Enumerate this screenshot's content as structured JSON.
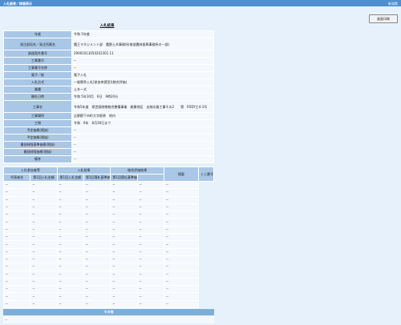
{
  "header": {
    "title": "入札結果／詳細表示",
    "right_label": "新潟県"
  },
  "toolbar": {
    "print_label": "画面印刷"
  },
  "result_title": "入札結果",
  "info_rows": [
    {
      "label": "年度",
      "value": "令和 5年度"
    },
    {
      "label": "発注部局名／発注所属名",
      "value": "農王マネジメント部　農野土木事務所(南部農林振興事務所の一部)"
    },
    {
      "label": "調達案件番号",
      "value": "29001013050202301 11"
    },
    {
      "label": "工事番号",
      "value": "--"
    },
    {
      "label": "工事番号名称",
      "value": "--"
    },
    {
      "label": "電子／紙",
      "value": "電子入札"
    },
    {
      "label": "入札方式",
      "value": "一般競争入札[参加申請型](総合評価)"
    },
    {
      "label": "業種",
      "value": "土木一式"
    },
    {
      "label": "開札日時",
      "value": "令和 5年10月　6日　9時20分"
    },
    {
      "label": "工事名",
      "value": "令和5年度　県営畑地帯総合整備事業　総康地区　支線水路工事その2　　第　R5DY工4-3号"
    },
    {
      "label": "工事場所",
      "value": "吉野郡下市町大字栃原　地内"
    },
    {
      "label": "工期",
      "value": "令和　6年　8月30日まで"
    },
    {
      "label": "予定価格(税抜)",
      "value": "--"
    },
    {
      "label": "予定価格(税抜)",
      "value": "--"
    },
    {
      "label": "最低制限基準価格(税抜)",
      "value": "--"
    },
    {
      "label": "最低制限価格(税抜)",
      "value": "--"
    },
    {
      "label": "備考",
      "value": "--"
    }
  ],
  "results_table": {
    "group_headers": [
      "入札参加者等",
      "入札結果",
      "総合評価結果",
      "摘要",
      "くじ番号"
    ],
    "sub_headers": [
      "代表者名",
      "第1回入札金額",
      "第1回入札金額",
      "第1回落札基準価格",
      "第1回落札基準価格"
    ],
    "rows": [
      [
        "--",
        "--",
        "--",
        "--",
        "--",
        "--",
        "--"
      ],
      [
        "--",
        "--",
        "--",
        "--",
        "--",
        "--",
        "--"
      ],
      [
        "--",
        "--",
        "--",
        "--",
        "--",
        "--",
        "--"
      ],
      [
        "--",
        "--",
        "--",
        "--",
        "--",
        "--",
        "--"
      ],
      [
        "--",
        "--",
        "--",
        "--",
        "--",
        "--",
        "--"
      ],
      [
        "--",
        "--",
        "--",
        "--",
        "--",
        "--",
        "--"
      ],
      [
        "--",
        "--",
        "--",
        "--",
        "--",
        "--",
        "--"
      ],
      [
        "--",
        "--",
        "--",
        "--",
        "--",
        "--",
        "--"
      ],
      [
        "--",
        "--",
        "--",
        "--",
        "--",
        "--",
        "--"
      ],
      [
        "--",
        "--",
        "--",
        "--",
        "--",
        "--",
        "--"
      ],
      [
        "--",
        "--",
        "--",
        "--",
        "--",
        "--",
        "--"
      ],
      [
        "--",
        "--",
        "--",
        "--",
        "--",
        "--",
        "--"
      ],
      [
        "--",
        "--",
        "--",
        "--",
        "--",
        "--",
        "--"
      ],
      [
        "--",
        "--",
        "--",
        "--",
        "--",
        "--",
        "--"
      ],
      [
        "--",
        "--",
        "--",
        "--",
        "--",
        "--",
        "--"
      ],
      [
        "--",
        "--",
        "--",
        "--",
        "--",
        "--",
        "--"
      ],
      [
        "--",
        "--",
        "--",
        "--",
        "--",
        "--",
        "--"
      ]
    ]
  },
  "other": {
    "title": "その他",
    "value": "--"
  }
}
